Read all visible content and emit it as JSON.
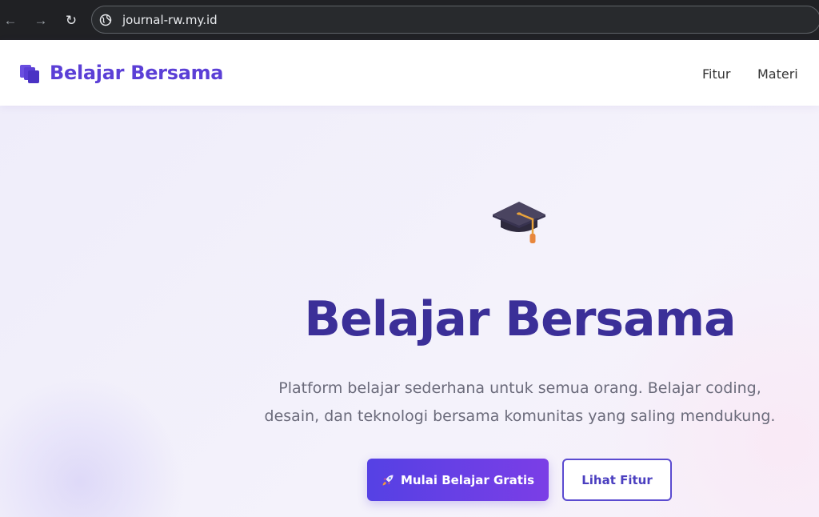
{
  "browser": {
    "url": "journal-rw.my.id",
    "back_glyph": "←",
    "forward_glyph": "→",
    "reload_glyph": "↻"
  },
  "header": {
    "brand": "Belajar Bersama",
    "brand_color": "#5b3fd6",
    "nav": [
      {
        "label": "Fitur"
      },
      {
        "label": "Materi"
      }
    ]
  },
  "hero": {
    "icon": "graduation-cap-icon",
    "title": "Belajar Bersama",
    "description": "Platform belajar sederhana untuk semua orang. Belajar coding, desain, dan teknologi bersama komunitas yang saling mendukung.",
    "primary_button": {
      "icon": "rocket-icon",
      "label": "Mulai Belajar Gratis"
    },
    "secondary_button": {
      "label": "Lihat Fitur"
    }
  },
  "colors": {
    "title": "#3b2f98",
    "primary_start": "#5541e4",
    "primary_end": "#7b3ee6",
    "outline": "#5b4bd0"
  }
}
